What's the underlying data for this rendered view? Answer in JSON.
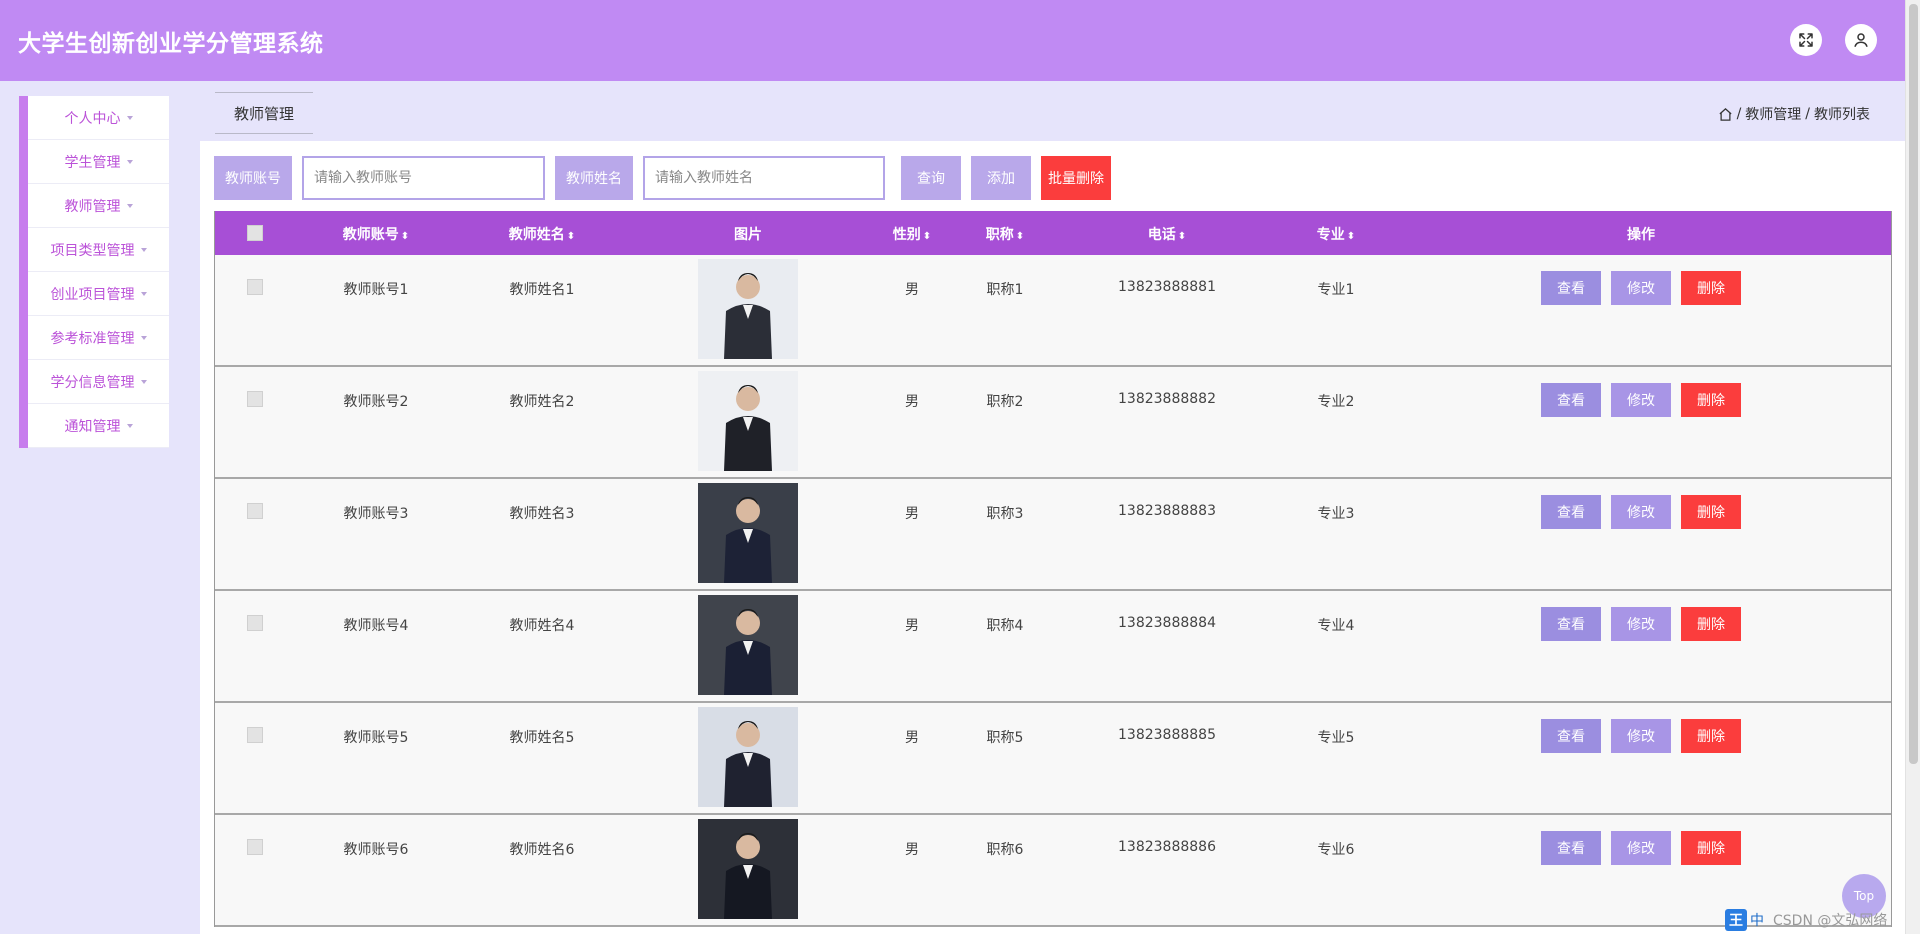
{
  "app": {
    "title": "大学生创新创业学分管理系统"
  },
  "sidebar": {
    "items": [
      {
        "label": "个人中心"
      },
      {
        "label": "学生管理"
      },
      {
        "label": "教师管理"
      },
      {
        "label": "项目类型管理"
      },
      {
        "label": "创业项目管理"
      },
      {
        "label": "参考标准管理"
      },
      {
        "label": "学分信息管理"
      },
      {
        "label": "通知管理"
      }
    ]
  },
  "page": {
    "tab": "教师管理",
    "breadcrumb": {
      "sep": "/",
      "level1": "教师管理",
      "level2": "教师列表"
    }
  },
  "search": {
    "account_label": "教师账号",
    "account_placeholder": "请输入教师账号",
    "name_label": "教师姓名",
    "name_placeholder": "请输入教师姓名",
    "query": "查询",
    "add": "添加",
    "batch_delete": "批量删除"
  },
  "table": {
    "headers": {
      "account": "教师账号",
      "name": "教师姓名",
      "photo": "图片",
      "gender": "性别",
      "title": "职称",
      "phone": "电话",
      "major": "专业",
      "actions": "操作"
    },
    "sort_icon": "sort-icon",
    "actions": {
      "view": "查看",
      "edit": "修改",
      "delete": "删除"
    },
    "rows": [
      {
        "account": "教师账号1",
        "name": "教师姓名1",
        "gender": "男",
        "title": "职称1",
        "phone": "13823888881",
        "major": "专业1"
      },
      {
        "account": "教师账号2",
        "name": "教师姓名2",
        "gender": "男",
        "title": "职称2",
        "phone": "13823888882",
        "major": "专业2"
      },
      {
        "account": "教师账号3",
        "name": "教师姓名3",
        "gender": "男",
        "title": "职称3",
        "phone": "13823888883",
        "major": "专业3"
      },
      {
        "account": "教师账号4",
        "name": "教师姓名4",
        "gender": "男",
        "title": "职称4",
        "phone": "13823888884",
        "major": "专业4"
      },
      {
        "account": "教师账号5",
        "name": "教师姓名5",
        "gender": "男",
        "title": "职称5",
        "phone": "13823888885",
        "major": "专业5"
      },
      {
        "account": "教师账号6",
        "name": "教师姓名6",
        "gender": "男",
        "title": "职称6",
        "phone": "13823888886",
        "major": "专业6"
      }
    ]
  },
  "footer": {
    "top": "Top",
    "watermark": "CSDN @文弘网络"
  },
  "tray": {
    "ime_logo": "王",
    "ime_mode": "中"
  },
  "colors": {
    "header": "#c08af3",
    "table_header": "#a74fd6",
    "sidebar_accent": "#c77ded",
    "button_secondary": "#b9a8ea",
    "danger": "#fb3d3d"
  }
}
